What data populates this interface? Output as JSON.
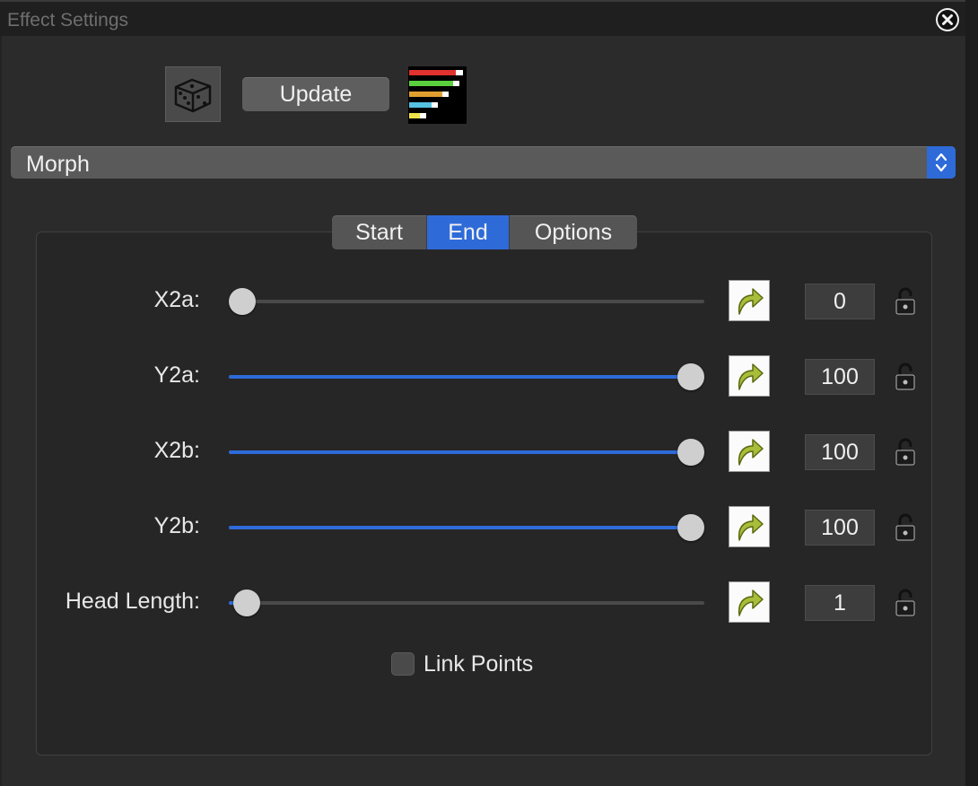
{
  "window": {
    "title": "Effect Settings",
    "close_icon": "close-icon"
  },
  "toolbar": {
    "randomize_icon": "dice-icon",
    "update_label": "Update",
    "palette_icon": "color-bars-icon",
    "palette_bar_colors": [
      "#e0322f",
      "#5ad03f",
      "#e0a030",
      "#55c1e0",
      "#f0e34a"
    ]
  },
  "effect_select": {
    "value": "Morph",
    "stepper_icon": "up-down-chevron-icon"
  },
  "tabs": [
    {
      "label": "Start",
      "active": false
    },
    {
      "label": "End",
      "active": true
    },
    {
      "label": "Options",
      "active": false
    }
  ],
  "params": [
    {
      "label": "X2a:",
      "value": "0",
      "slider_fraction": 0.0
    },
    {
      "label": "Y2a:",
      "value": "100",
      "slider_fraction": 1.0
    },
    {
      "label": "X2b:",
      "value": "100",
      "slider_fraction": 1.0
    },
    {
      "label": "Y2b:",
      "value": "100",
      "slider_fraction": 1.0
    },
    {
      "label": "Head Length:",
      "value": "1",
      "slider_fraction": 0.01
    }
  ],
  "link_points": {
    "label": "Link Points",
    "checked": false
  },
  "colors": {
    "accent": "#2e6bd9",
    "background": "#2b2b2b"
  }
}
